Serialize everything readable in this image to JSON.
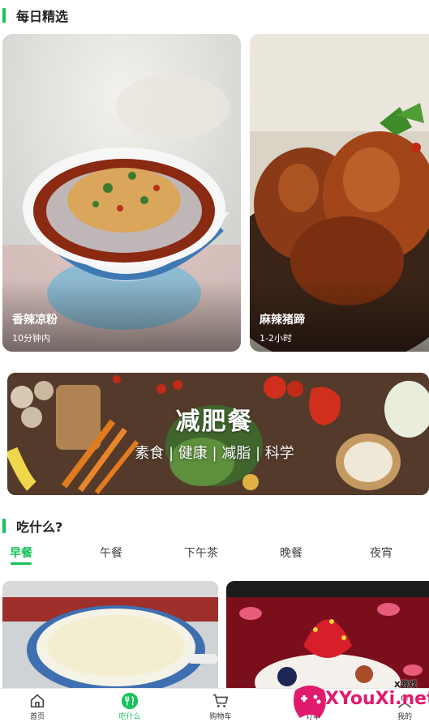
{
  "daily": {
    "title": "每日精选",
    "cards": [
      {
        "title": "香辣凉粉",
        "time": "10分钟内"
      },
      {
        "title": "麻辣猪蹄",
        "time": "1-2小时"
      }
    ]
  },
  "banner": {
    "title": "减肥餐",
    "subtitle": "素食 | 健康 | 减脂 | 科学"
  },
  "what_to_eat": {
    "title": "吃什么?",
    "tabs": [
      "早餐",
      "午餐",
      "下午茶",
      "晚餐",
      "夜宵"
    ],
    "active_tab": "早餐"
  },
  "bottom_nav": {
    "items": [
      {
        "label": "首页",
        "icon": "home-icon"
      },
      {
        "label": "吃什么",
        "icon": "fork-knife-icon"
      },
      {
        "label": "购物车",
        "icon": "cart-icon"
      },
      {
        "label": "订单",
        "icon": "order-icon"
      },
      {
        "label": "我的",
        "icon": "profile-icon"
      }
    ],
    "active": "吃什么"
  },
  "watermark": {
    "brand": "XYouXi.net",
    "tag": "X游戏"
  },
  "colors": {
    "accent": "#16c45a",
    "watermark": "#e21a6d"
  }
}
